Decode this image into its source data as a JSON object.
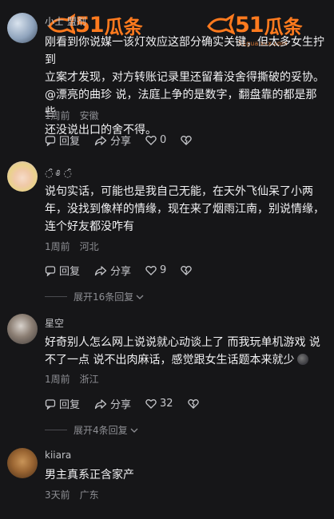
{
  "watermark": {
    "num": "51",
    "cn": "瓜条",
    "url": "51gua.xxx.com"
  },
  "actions_labels": {
    "reply": "回复",
    "share": "分享"
  },
  "comments": [
    {
      "username": "小士 盟剂",
      "text_lines": [
        "刚看到你说媒一该灯效应这部分确实关键，但太多女生拧到",
        "立案才发现，对方转账记录里还留着没舍得撕破的妥协。",
        "@漂亮的曲珍 说，法庭上争的是数字，翻盘靠的都是那些",
        "还没说出口的舍不得。"
      ],
      "time": "1周前",
      "location": "安徽",
      "likes": "0"
    },
    {
      "username": "◌̑̈ ༅ ◌̑̈",
      "text_lines": [
        "说句实话，可能也是我自己无能，在天外飞仙呆了小两",
        "年，没找到像样的情缘，现在来了烟雨江南，别说情缘，",
        "连个好友都没咋有"
      ],
      "time": "1周前",
      "location": "河北",
      "likes": "9",
      "expand": "展开16条回复"
    },
    {
      "username": "星空",
      "text_lines": [
        "好奇别人怎么网上说说就心动谈上了  而我玩单机游戏  说",
        "不了一点  说不出肉麻话，感觉跟女生话题本来就少"
      ],
      "time": "1周前",
      "location": "浙江",
      "likes": "32",
      "expand": "展开4条回复"
    },
    {
      "username": "kiiara",
      "text_lines": [
        "男主真系正含家产"
      ],
      "time": "3天前",
      "location": "广东"
    }
  ],
  "colors": {
    "accent": "#ff7a1e",
    "background": "#161618"
  },
  "icons": [
    "reply-icon",
    "share-icon",
    "like-icon",
    "dislike-icon",
    "chevron-down-icon"
  ]
}
